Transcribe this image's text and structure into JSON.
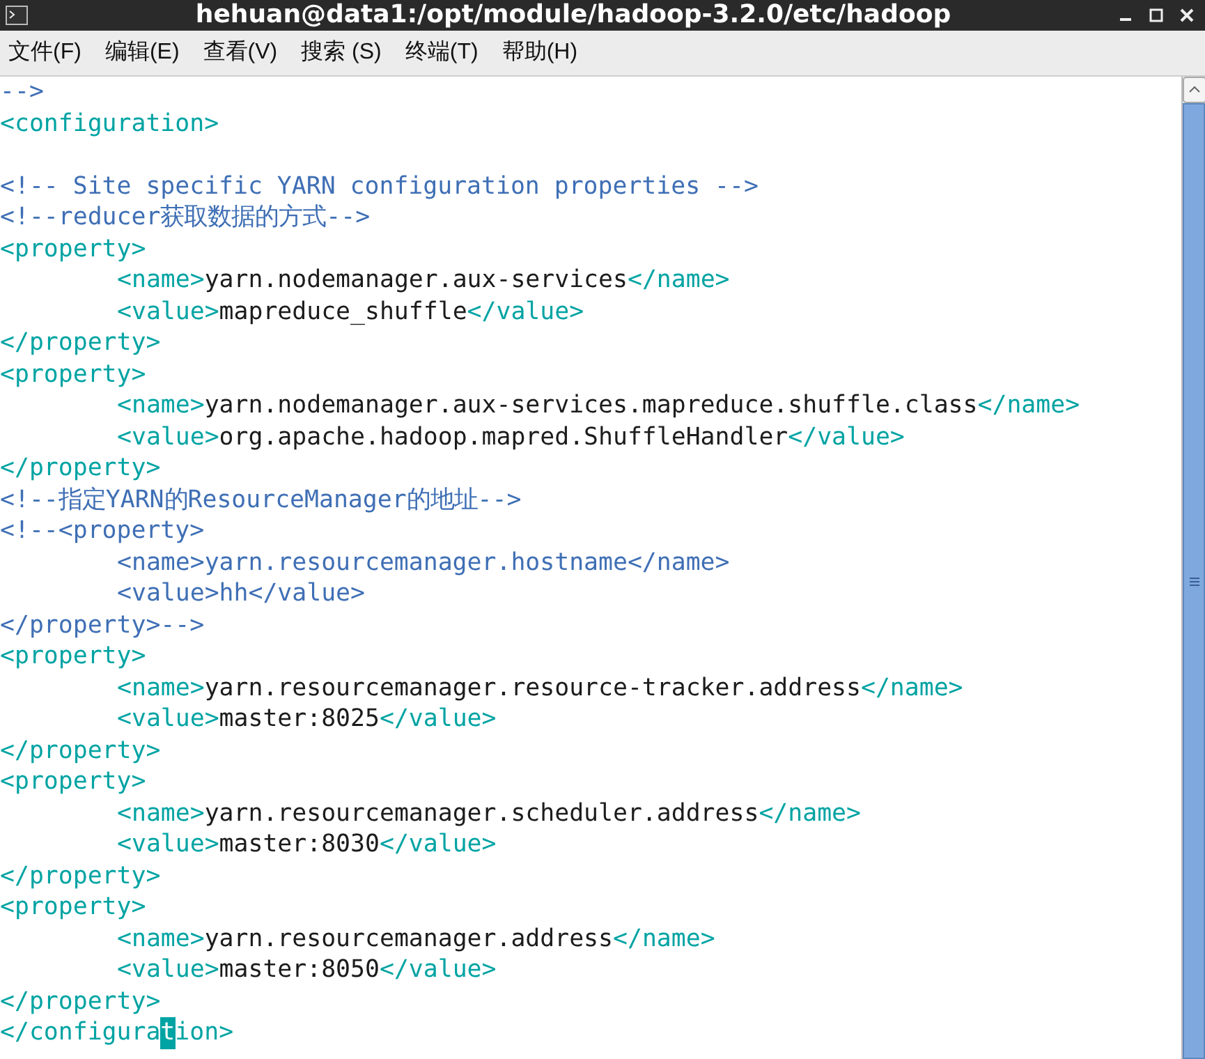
{
  "window": {
    "title": "hehuan@data1:/opt/module/hadoop-3.2.0/etc/hadoop"
  },
  "menu": [
    "文件(F)",
    "编辑(E)",
    "查看(V)",
    "搜索 (S)",
    "终端(T)",
    "帮助(H)"
  ],
  "editor": {
    "lines": [
      {
        "indented": false,
        "segments": [
          {
            "kind": "comment",
            "text": "-->"
          }
        ]
      },
      {
        "indented": false,
        "segments": [
          {
            "kind": "tag",
            "text": "<configuration>"
          }
        ]
      },
      {
        "indented": false,
        "blank_line_before": true,
        "segments": [
          {
            "kind": "comment",
            "text": "<!-- Site specific YARN configuration properties -->"
          }
        ]
      },
      {
        "indented": false,
        "segments": [
          {
            "kind": "comment",
            "text": "<!--reducer获取数据的方式-->"
          }
        ]
      },
      {
        "indented": false,
        "segments": [
          {
            "kind": "tag",
            "text": "<property>"
          }
        ]
      },
      {
        "indented": true,
        "segments": [
          {
            "kind": "tag",
            "text": "<name>"
          },
          {
            "kind": "text",
            "text": "yarn.nodemanager.aux-services"
          },
          {
            "kind": "tag",
            "text": "</name>"
          }
        ]
      },
      {
        "indented": true,
        "segments": [
          {
            "kind": "tag",
            "text": "<value>"
          },
          {
            "kind": "text",
            "text": "mapreduce_shuffle"
          },
          {
            "kind": "tag",
            "text": "</value>"
          }
        ]
      },
      {
        "indented": false,
        "segments": [
          {
            "kind": "tag",
            "text": "</property>"
          }
        ]
      },
      {
        "indented": false,
        "segments": [
          {
            "kind": "tag",
            "text": "<property>"
          }
        ]
      },
      {
        "indented": true,
        "segments": [
          {
            "kind": "tag",
            "text": "<name>"
          },
          {
            "kind": "text",
            "text": "yarn.nodemanager.aux-services.mapreduce.shuffle.class"
          },
          {
            "kind": "tag",
            "text": "</name>"
          }
        ]
      },
      {
        "indented": true,
        "segments": [
          {
            "kind": "tag",
            "text": "<value>"
          },
          {
            "kind": "text",
            "text": "org.apache.hadoop.mapred.ShuffleHandler"
          },
          {
            "kind": "tag",
            "text": "</value>"
          }
        ]
      },
      {
        "indented": false,
        "segments": [
          {
            "kind": "tag",
            "text": "</property>"
          }
        ]
      },
      {
        "indented": false,
        "segments": [
          {
            "kind": "comment",
            "text": "<!--指定YARN的ResourceManager的地址-->"
          }
        ]
      },
      {
        "indented": false,
        "segments": [
          {
            "kind": "comment",
            "text": "<!--<property>"
          }
        ]
      },
      {
        "indented": true,
        "segments": [
          {
            "kind": "comment",
            "text": "<name>yarn.resourcemanager.hostname</name>"
          }
        ]
      },
      {
        "indented": true,
        "segments": [
          {
            "kind": "comment",
            "text": "<value>hh</value>"
          }
        ]
      },
      {
        "indented": false,
        "segments": [
          {
            "kind": "comment",
            "text": "</property>-->"
          }
        ]
      },
      {
        "indented": false,
        "segments": [
          {
            "kind": "tag",
            "text": "<property>"
          }
        ]
      },
      {
        "indented": true,
        "segments": [
          {
            "kind": "tag",
            "text": "<name>"
          },
          {
            "kind": "text",
            "text": "yarn.resourcemanager.resource-tracker.address"
          },
          {
            "kind": "tag",
            "text": "</name>"
          }
        ]
      },
      {
        "indented": true,
        "segments": [
          {
            "kind": "tag",
            "text": "<value>"
          },
          {
            "kind": "text",
            "text": "master:8025"
          },
          {
            "kind": "tag",
            "text": "</value>"
          }
        ]
      },
      {
        "indented": false,
        "segments": [
          {
            "kind": "tag",
            "text": "</property>"
          }
        ]
      },
      {
        "indented": false,
        "segments": [
          {
            "kind": "tag",
            "text": "<property>"
          }
        ]
      },
      {
        "indented": true,
        "segments": [
          {
            "kind": "tag",
            "text": "<name>"
          },
          {
            "kind": "text",
            "text": "yarn.resourcemanager.scheduler.address"
          },
          {
            "kind": "tag",
            "text": "</name>"
          }
        ]
      },
      {
        "indented": true,
        "segments": [
          {
            "kind": "tag",
            "text": "<value>"
          },
          {
            "kind": "text",
            "text": "master:8030"
          },
          {
            "kind": "tag",
            "text": "</value>"
          }
        ]
      },
      {
        "indented": false,
        "segments": [
          {
            "kind": "tag",
            "text": "</property>"
          }
        ]
      },
      {
        "indented": false,
        "segments": [
          {
            "kind": "tag",
            "text": "<property>"
          }
        ]
      },
      {
        "indented": true,
        "segments": [
          {
            "kind": "tag",
            "text": "<name>"
          },
          {
            "kind": "text",
            "text": "yarn.resourcemanager.address"
          },
          {
            "kind": "tag",
            "text": "</name>"
          }
        ]
      },
      {
        "indented": true,
        "segments": [
          {
            "kind": "tag",
            "text": "<value>"
          },
          {
            "kind": "text",
            "text": "master:8050"
          },
          {
            "kind": "tag",
            "text": "</value>"
          }
        ]
      },
      {
        "indented": false,
        "segments": [
          {
            "kind": "tag",
            "text": "</property>"
          }
        ]
      },
      {
        "indented": false,
        "segments": [
          {
            "kind": "tag",
            "text": "</configura"
          },
          {
            "kind": "cursor",
            "text": "t"
          },
          {
            "kind": "tag",
            "text": "ion>"
          }
        ]
      }
    ]
  }
}
